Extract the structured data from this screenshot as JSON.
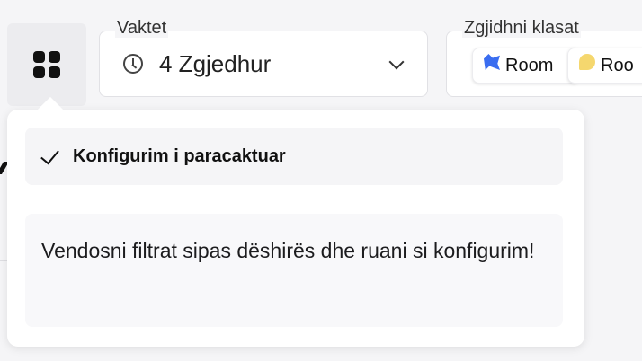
{
  "filters": {
    "shifts_label": "Vaktet",
    "shifts_value": "4 Zgjedhur",
    "classes_label": "Zgjidhni klasat",
    "class_chips": [
      {
        "label": "Room",
        "icon": "blue-shape-icon",
        "color": "#3a6df0"
      },
      {
        "label": "Roo",
        "icon": "yellow-shape-icon",
        "color": "#f5d76e"
      }
    ]
  },
  "popover": {
    "preset_label": "Konfigurim i paracaktuar",
    "hint_text": "Vendosni filtrat sipas dëshirës dhe ruani si konfigurim!"
  },
  "icons": {
    "grid": "grid-icon",
    "clock": "clock-icon",
    "chevron": "chevron-down-icon",
    "check": "check-icon"
  }
}
